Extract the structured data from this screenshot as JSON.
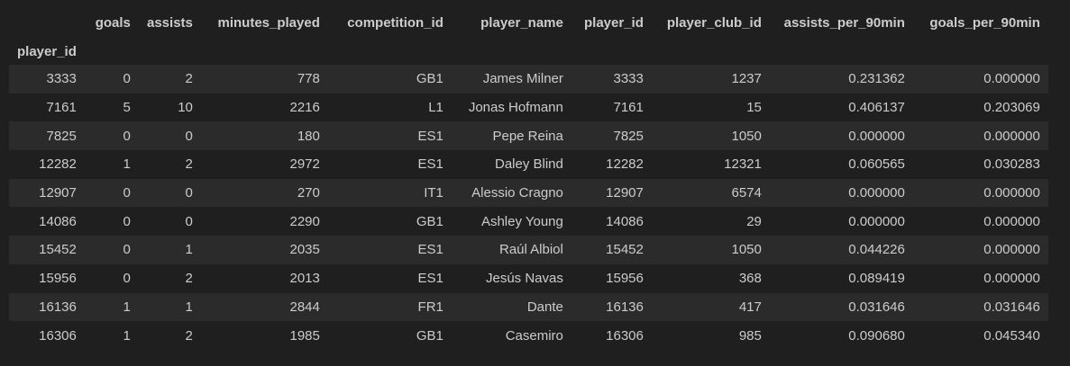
{
  "table": {
    "index_name": "player_id",
    "columns": [
      "goals",
      "assists",
      "minutes_played",
      "competition_id",
      "player_name",
      "player_id",
      "player_club_id",
      "assists_per_90min",
      "goals_per_90min"
    ],
    "rows": [
      {
        "index": "3333",
        "cells": [
          "0",
          "2",
          "778",
          "GB1",
          "James Milner",
          "3333",
          "1237",
          "0.231362",
          "0.000000"
        ]
      },
      {
        "index": "7161",
        "cells": [
          "5",
          "10",
          "2216",
          "L1",
          "Jonas Hofmann",
          "7161",
          "15",
          "0.406137",
          "0.203069"
        ]
      },
      {
        "index": "7825",
        "cells": [
          "0",
          "0",
          "180",
          "ES1",
          "Pepe Reina",
          "7825",
          "1050",
          "0.000000",
          "0.000000"
        ]
      },
      {
        "index": "12282",
        "cells": [
          "1",
          "2",
          "2972",
          "ES1",
          "Daley Blind",
          "12282",
          "12321",
          "0.060565",
          "0.030283"
        ]
      },
      {
        "index": "12907",
        "cells": [
          "0",
          "0",
          "270",
          "IT1",
          "Alessio Cragno",
          "12907",
          "6574",
          "0.000000",
          "0.000000"
        ]
      },
      {
        "index": "14086",
        "cells": [
          "0",
          "0",
          "2290",
          "GB1",
          "Ashley Young",
          "14086",
          "29",
          "0.000000",
          "0.000000"
        ]
      },
      {
        "index": "15452",
        "cells": [
          "0",
          "1",
          "2035",
          "ES1",
          "Raúl Albiol",
          "15452",
          "1050",
          "0.044226",
          "0.000000"
        ]
      },
      {
        "index": "15956",
        "cells": [
          "0",
          "2",
          "2013",
          "ES1",
          "Jesús Navas",
          "15956",
          "368",
          "0.089419",
          "0.000000"
        ]
      },
      {
        "index": "16136",
        "cells": [
          "1",
          "1",
          "2844",
          "FR1",
          "Dante",
          "16136",
          "417",
          "0.031646",
          "0.031646"
        ]
      },
      {
        "index": "16306",
        "cells": [
          "1",
          "2",
          "1985",
          "GB1",
          "Casemiro",
          "16306",
          "985",
          "0.090680",
          "0.045340"
        ]
      }
    ]
  },
  "colors": {
    "background": "#1f1f1f",
    "row_stripe": "#2b2b2b",
    "text": "#cccccc"
  }
}
